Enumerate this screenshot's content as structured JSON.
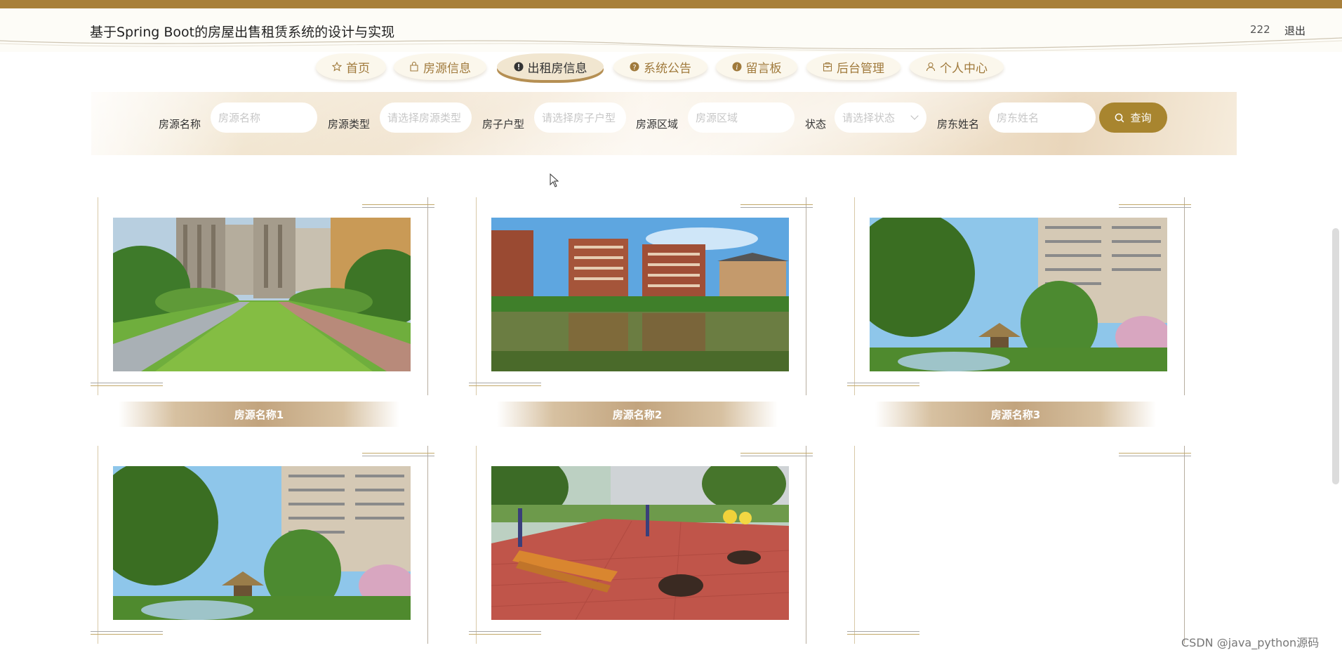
{
  "header": {
    "title": "基于Spring Boot的房屋出售租赁系统的设计与实现",
    "user": "222",
    "logout": "退出"
  },
  "nav": {
    "items": [
      {
        "label": "首页",
        "icon": "star-icon"
      },
      {
        "label": "房源信息",
        "icon": "bag-icon"
      },
      {
        "label": "出租房信息",
        "icon": "alert-circle-icon",
        "active": true
      },
      {
        "label": "系统公告",
        "icon": "question-circle-icon"
      },
      {
        "label": "留言板",
        "icon": "info-circle-icon"
      },
      {
        "label": "后台管理",
        "icon": "box-icon"
      },
      {
        "label": "个人中心",
        "icon": "user-icon"
      }
    ]
  },
  "search": {
    "fields": [
      {
        "label": "房源名称",
        "placeholder": "房源名称"
      },
      {
        "label": "房源类型",
        "placeholder": "请选择房源类型"
      },
      {
        "label": "房子户型",
        "placeholder": "请选择房子户型"
      },
      {
        "label": "房源区域",
        "placeholder": "房源区域"
      },
      {
        "label": "状态",
        "placeholder": "请选择状态"
      },
      {
        "label": "房东姓名",
        "placeholder": "房东姓名"
      }
    ],
    "button": "查询"
  },
  "listings": [
    {
      "name": "房源名称1",
      "image": "garden-lawn"
    },
    {
      "name": "房源名称2",
      "image": "lake-buildings"
    },
    {
      "name": "房源名称3",
      "image": "garden-pavilion"
    },
    {
      "name": "",
      "image": "garden-pavilion"
    },
    {
      "name": "",
      "image": "plaza-bench"
    },
    {
      "name": "",
      "image": ""
    }
  ],
  "watermark": "CSDN @java_python源码",
  "colors": {
    "accent": "#a8852f",
    "topbar": "#a8803a",
    "nav_text": "#a07a3c"
  }
}
